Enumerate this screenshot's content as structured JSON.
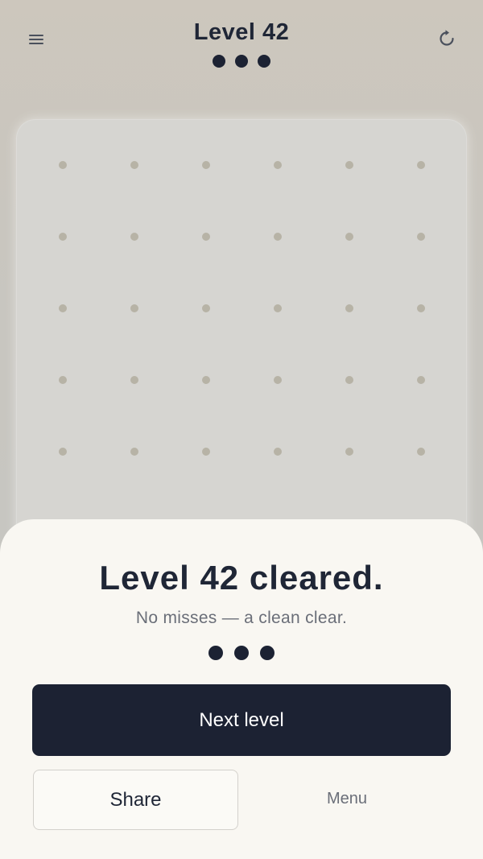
{
  "header": {
    "title": "Level 42",
    "menu_icon": "hamburger-menu-icon",
    "restart_icon": "restart-icon",
    "stars_earned": 3
  },
  "board": {
    "columns": 6,
    "rows": 5
  },
  "result_sheet": {
    "title": "Level 42 cleared.",
    "subtitle": "No misses — a clean clear.",
    "stars_earned": 3,
    "next_label": "Next level",
    "share_label": "Share",
    "menu_label": "Menu"
  },
  "colors": {
    "ink": "#1c2233",
    "grid_dot": "#b7b3a6",
    "board": "#d6d5d1",
    "sheet": "#f9f7f2",
    "muted_text": "#6a6e78"
  }
}
